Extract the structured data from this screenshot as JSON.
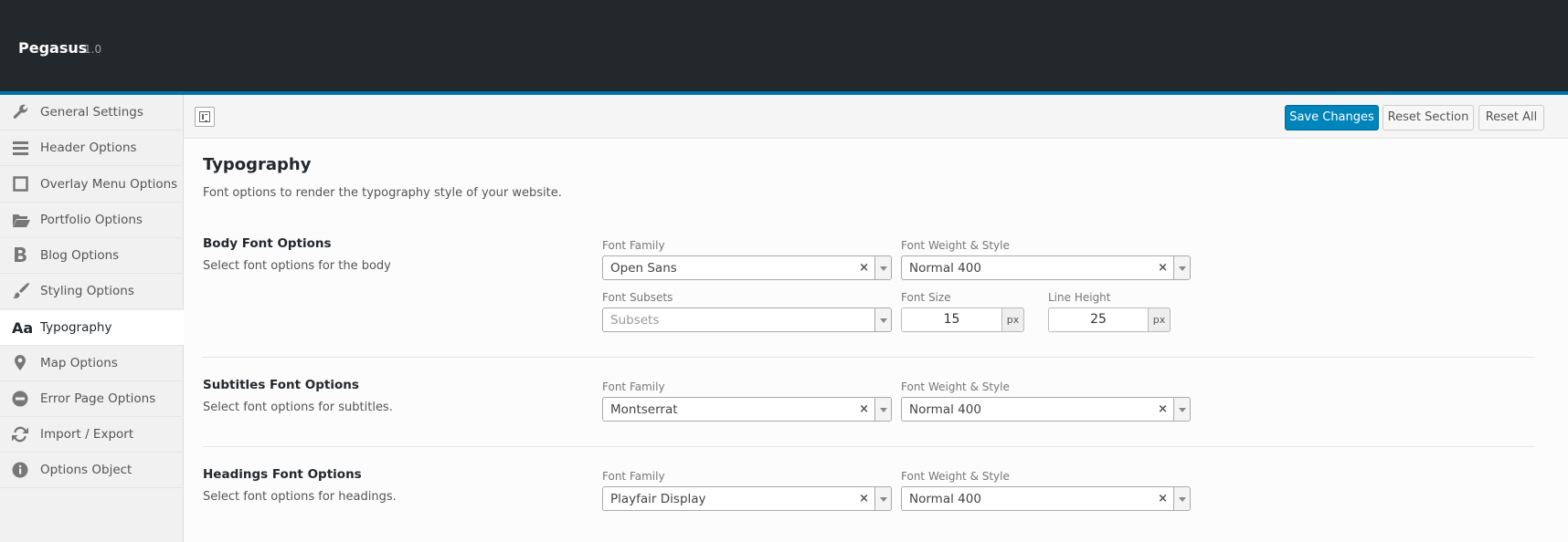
{
  "header": {
    "brand": "Pegasus",
    "version": "1.0"
  },
  "sidebar": {
    "items": [
      {
        "label": "General Settings",
        "icon": "wrench-icon"
      },
      {
        "label": "Header Options",
        "icon": "menu-lines-icon"
      },
      {
        "label": "Overlay Menu Options",
        "icon": "square-outline-icon"
      },
      {
        "label": "Portfolio Options",
        "icon": "folder-open-icon"
      },
      {
        "label": "Blog Options",
        "icon": "bold-b-icon"
      },
      {
        "label": "Styling Options",
        "icon": "brush-icon"
      },
      {
        "label": "Typography",
        "icon": "font-aa-icon",
        "icon_text": "Aa",
        "active": true
      },
      {
        "label": "Map Options",
        "icon": "map-pin-icon"
      },
      {
        "label": "Error Page Options",
        "icon": "minus-circle-icon"
      },
      {
        "label": "Import / Export",
        "icon": "refresh-icon"
      },
      {
        "label": "Options Object",
        "icon": "info-circle-icon"
      }
    ]
  },
  "toolbar": {
    "save_label": "Save Changes",
    "reset_section_label": "Reset Section",
    "reset_all_label": "Reset All"
  },
  "section": {
    "title": "Typography",
    "description": "Font options to render the typography style of your website."
  },
  "body_font": {
    "title": "Body Font Options",
    "description": "Select font options for the body",
    "family_label": "Font Family",
    "family_value": "Open Sans",
    "weight_label": "Font Weight & Style",
    "weight_value": "Normal 400",
    "subsets_label": "Font Subsets",
    "subsets_placeholder": "Subsets",
    "size_label": "Font Size",
    "size_value": "15",
    "size_unit": "px",
    "line_height_label": "Line Height",
    "line_height_value": "25",
    "line_height_unit": "px"
  },
  "subtitles_font": {
    "title": "Subtitles Font Options",
    "description": "Select font options for subtitles.",
    "family_label": "Font Family",
    "family_value": "Montserrat",
    "weight_label": "Font Weight & Style",
    "weight_value": "Normal 400"
  },
  "headings_font": {
    "title": "Headings Font Options",
    "description": "Select font options for headings.",
    "family_label": "Font Family",
    "family_value": "Playfair Display",
    "weight_label": "Font Weight & Style",
    "weight_value": "Normal 400"
  },
  "colors": {
    "header_bg": "#23282d",
    "accent": "#0073aa",
    "primary_button": "#0085ba"
  }
}
